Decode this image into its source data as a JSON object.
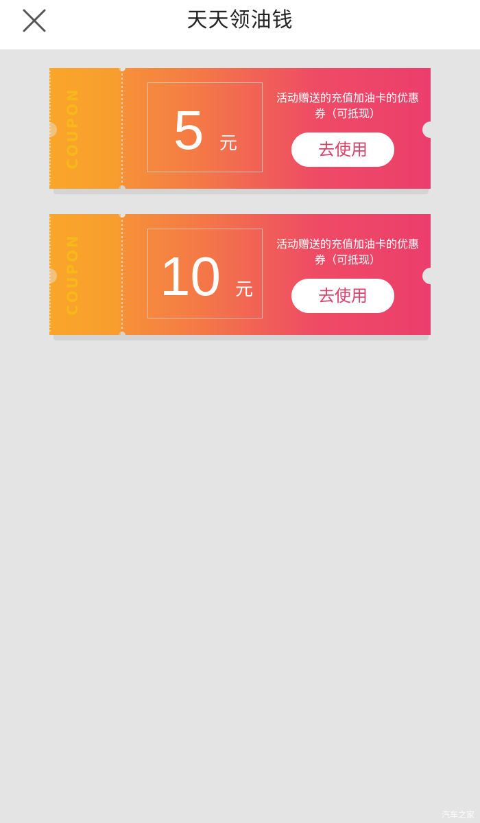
{
  "header": {
    "title": "天天领油钱",
    "close_icon": "close-icon"
  },
  "coupons": [
    {
      "stub_label": "COUPON",
      "amount": "5",
      "unit": "元",
      "description": "活动赠送的充值加油卡的优惠券（可抵现）",
      "button_label": "去使用"
    },
    {
      "stub_label": "COUPON",
      "amount": "10",
      "unit": "元",
      "description": "活动赠送的充值加油卡的优惠券（可抵现）",
      "button_label": "去使用"
    }
  ],
  "watermark": "汽车之家",
  "colors": {
    "gradient_start": "#f9a62c",
    "gradient_end": "#ee3f6c",
    "stub_text": "#f6b81a",
    "button_text": "#d9436a",
    "background": "#e4e4e4"
  }
}
